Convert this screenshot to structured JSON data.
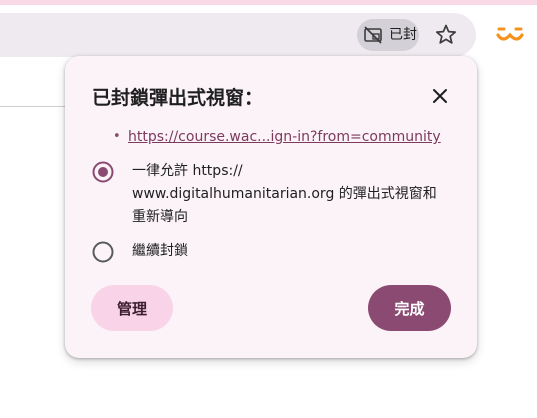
{
  "toolbar": {
    "popup_chip_label": "已封",
    "popup_chip_icon": "popup-blocked-icon",
    "bookmark_icon": "star-icon",
    "extension_icon": "extension-smile-icon"
  },
  "bubble": {
    "title": "已封鎖彈出式視窗：",
    "close_icon": "close-icon",
    "blocked_urls": [
      {
        "bullet": "•",
        "url": "https://course.wac...ign-in?from=community"
      }
    ],
    "options": {
      "allow": {
        "selected": true,
        "lines": [
          "一律允許 https://",
          "www.digitalhumanitarian.org 的彈出式視窗和",
          "重新導向"
        ]
      },
      "keep_blocking": {
        "selected": false,
        "label": "繼續封鎖"
      }
    },
    "buttons": {
      "manage": "管理",
      "done": "完成"
    }
  },
  "colors": {
    "accent": "#8b4a72",
    "manage_button_bg": "#f9d4e8",
    "bubble_bg": "#fbf3f8",
    "link": "#7c3a5e",
    "extension_orange": "#f5921e"
  }
}
